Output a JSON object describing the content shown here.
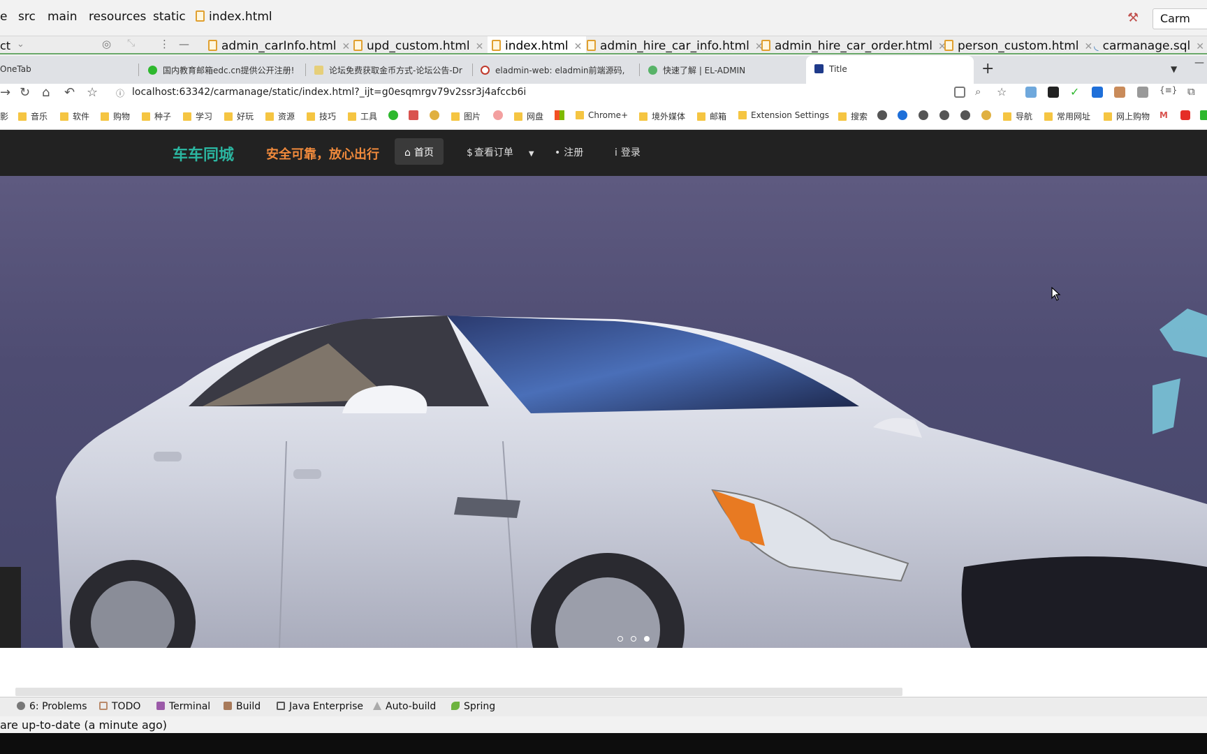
{
  "ide": {
    "breadcrumbs": [
      "e",
      "src",
      "main",
      "resources",
      "static",
      "index.html"
    ],
    "run_config": "Carm",
    "project_label": "ct",
    "tabs": [
      {
        "label": "admin_carInfo.html",
        "active": false
      },
      {
        "label": "upd_custom.html",
        "active": false
      },
      {
        "label": "index.html",
        "active": true
      },
      {
        "label": "admin_hire_car_info.html",
        "active": false
      },
      {
        "label": "admin_hire_car_order.html",
        "active": false
      },
      {
        "label": "person_custom.html",
        "active": false
      },
      {
        "label": "carmanage.sql",
        "active": false
      }
    ],
    "tool_windows": [
      "6: Problems",
      "TODO",
      "Terminal",
      "Build",
      "Java Enterprise",
      "Auto-build",
      "Spring"
    ],
    "status": "are up-to-date (a minute ago)"
  },
  "browser": {
    "tabs": [
      {
        "label": "OneTab",
        "color": "#3a7bd5"
      },
      {
        "label": "国内教育邮箱edc.cn提供公开注册!",
        "color": "#2eb82e"
      },
      {
        "label": "论坛免费获取金币方式-论坛公告-Dr",
        "color": "#e0c060"
      },
      {
        "label": "eladmin-web: eladmin前端源码,",
        "color": "#c0392b"
      },
      {
        "label": "快速了解 | EL-ADMIN",
        "color": "#58b368"
      },
      {
        "label": "Title",
        "color": "#1e3a8a"
      }
    ],
    "url": "localhost:63342/carmanage/static/index.html?_ijt=g0esqmrgv79v2ssr3j4afccb6i",
    "bookmarks": [
      "影",
      "音乐",
      "软件",
      "购物",
      "种子",
      "学习",
      "好玩",
      "资源",
      "技巧",
      "工具",
      "图片",
      "网盘",
      "Chrome+",
      "境外媒体",
      "邮箱",
      "Extension Settings",
      "搜索",
      "导航",
      "常用网址",
      "网上购物"
    ]
  },
  "site": {
    "brand": "车车同城",
    "slogan": "安全可靠，放心出行",
    "menu": [
      {
        "label": "首页",
        "icon": "home-icon",
        "glyph": "⌂"
      },
      {
        "label": "查看订单",
        "icon": "dollar-icon",
        "glyph": "$"
      },
      {
        "label": "注册",
        "icon": "lightbulb-icon",
        "glyph": "•"
      },
      {
        "label": "登录",
        "icon": "info-icon",
        "glyph": "i"
      }
    ],
    "carousel": {
      "slides": 3,
      "active": 3
    }
  }
}
